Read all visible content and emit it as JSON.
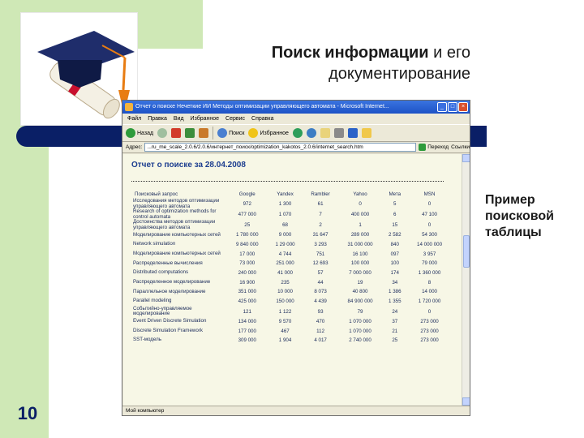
{
  "slide": {
    "title_bold": "Поиск информации",
    "title_rest": " и его",
    "title_line2": "документирование",
    "side_note": [
      "Пример",
      "поисковой",
      "таблицы"
    ],
    "page_number": "10"
  },
  "browser": {
    "window_title": "Отчет о поиске Нечеткие ИИ Методы оптимизации управляющего автомата - Microsoft Internet...",
    "window_buttons": [
      "_",
      "□",
      "×"
    ],
    "menu": [
      "Файл",
      "Правка",
      "Вид",
      "Избранное",
      "Сервис",
      "Справка"
    ],
    "toolbar": {
      "back": "Назад",
      "search": "Поиск",
      "favorites": "Избранное"
    },
    "address_label": "Адрес:",
    "address_value": "...ru_me_scale_2.0.6/2.0.6/интернет_поиск/optimization_kakotos_2.0.6/internet_search.htm",
    "go_label": "Переход",
    "links_label": "Ссылки",
    "status_text": "Мой компьютер"
  },
  "report": {
    "title": "Отчет о поиске за 28.04.2008",
    "columns": [
      "Поисковый запрос",
      "Google",
      "Yandex",
      "Rambler",
      "Yahoo",
      "Mета",
      "MSN"
    ],
    "rows": [
      [
        "Исследования методов оптимизации управляющего автомата",
        "972",
        "1 300",
        "61",
        "0",
        "5",
        "0"
      ],
      [
        "Research of optimization methods for control automata",
        "477 000",
        "1 070",
        "7",
        "400 000",
        "6",
        "47 100"
      ],
      [
        "Достоинства методов оптимизации управляющего автомата",
        "25",
        "68",
        "2",
        "1",
        "15",
        "0"
      ],
      [
        "Моделирование компьютерных сетей",
        "1 780 000",
        "9 000",
        "31 647",
        "289 000",
        "2 582",
        "54 300"
      ],
      [
        "Network simulation",
        "9 840 000",
        "1 29 000",
        "3 293",
        "31 000 000",
        "840",
        "14 000 000"
      ],
      [
        "Моделирование компьютерных сетей",
        "17 000",
        "4 744",
        "751",
        "16 100",
        "097",
        "3 957"
      ],
      [
        "Распределенные вычисления",
        "73 000",
        "251 000",
        "12 693",
        "100 000",
        "100",
        "79 000"
      ],
      [
        "Distributed computations",
        "240 000",
        "41 000",
        "57",
        "7 000 000",
        "174",
        "1 360 000"
      ],
      [
        "Распределенное моделирование",
        "16 900",
        "235",
        "44",
        "19",
        "34",
        "8"
      ],
      [
        "Параллельное моделирование",
        "351 000",
        "10 000",
        "8 073",
        "40 800",
        "1 386",
        "14 000"
      ],
      [
        "Parallel modeling",
        "425 000",
        "150 000",
        "4 439",
        "84 900 000",
        "1 355",
        "1 720 000"
      ],
      [
        "Событийно-управляемое моделирование",
        "121",
        "1 122",
        "93",
        "79",
        "24",
        "0"
      ],
      [
        "Event Driven Discrete Simulation",
        "134 000",
        "9 570",
        "470",
        "1 070 000",
        "37",
        "273 000"
      ],
      [
        "Discrete Simulation Framework",
        "177 000",
        "467",
        "112",
        "1 070 000",
        "21",
        "273 000"
      ],
      [
        "SST-модель",
        "309 000",
        "1 904",
        "4 017",
        "2 740 000",
        "25",
        "273 000"
      ]
    ]
  }
}
